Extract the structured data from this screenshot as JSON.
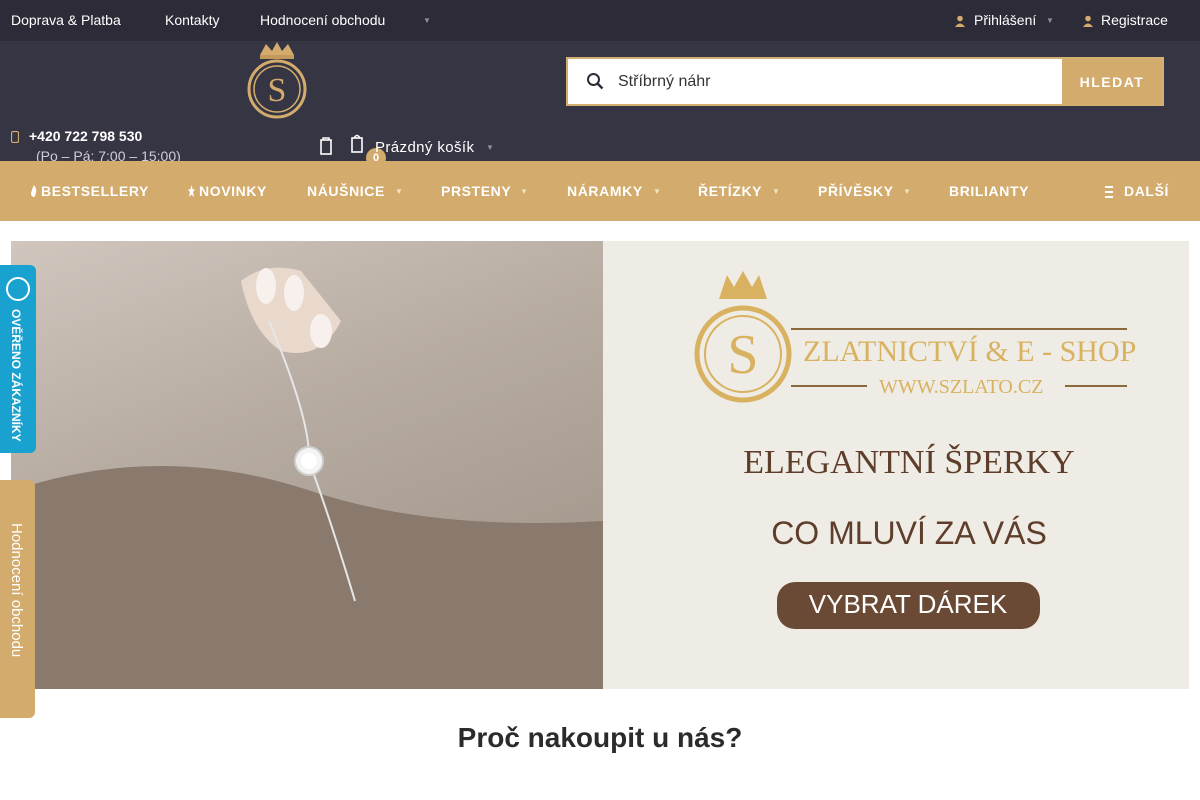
{
  "topbar": {
    "links": [
      "Doprava & Platba",
      "Kontakty",
      "Hodnocení obchodu"
    ],
    "login_label": "Přihlášení",
    "register_label": "Registrace"
  },
  "search": {
    "placeholder": "Stříbrný náhr",
    "button_label": "HLEDAT"
  },
  "contact": {
    "phone": "+420 722 798 530",
    "hours": "(Po – Pá: 7:00 – 15:00)"
  },
  "cart": {
    "label": "Prázdný košík",
    "count": "0"
  },
  "nav": {
    "items": [
      "BESTSELLERY",
      "NOVINKY",
      "NÁUŠNICE",
      "PRSTENY",
      "NÁRAMKY",
      "ŘETÍZKY",
      "PŘÍVĚSKY",
      "BRILIANTY"
    ],
    "more_label": "DALŠÍ"
  },
  "banner": {
    "brand_initial": "S",
    "brand_name": "ZLATNICTVÍ & E - SHOP",
    "brand_url": "WWW.SZLATO.CZ",
    "headline": "ELEGANTNÍ ŠPERKY",
    "subheadline": "CO MLUVÍ ZA VÁS",
    "cta_label": "VYBRAT DÁREK"
  },
  "side_tabs": {
    "verified_label": "OVĚŘENO ZÁKAZNÍKY",
    "review_label": "Hodnocení obchodu"
  },
  "section_title": "Proč nakoupit u nás?",
  "colors": {
    "topbar_bg": "#2c2b37",
    "header_bg": "#363544",
    "accent_gold": "#d3ab6c",
    "cta_brown": "#6b4a35",
    "verified_blue": "#19a2d0"
  },
  "icons": [
    "user-icon",
    "register-icon",
    "search-icon",
    "phone-icon",
    "compare-icon",
    "cart-icon",
    "fire-icon",
    "star-icon",
    "menu-icon",
    "crown-icon"
  ]
}
